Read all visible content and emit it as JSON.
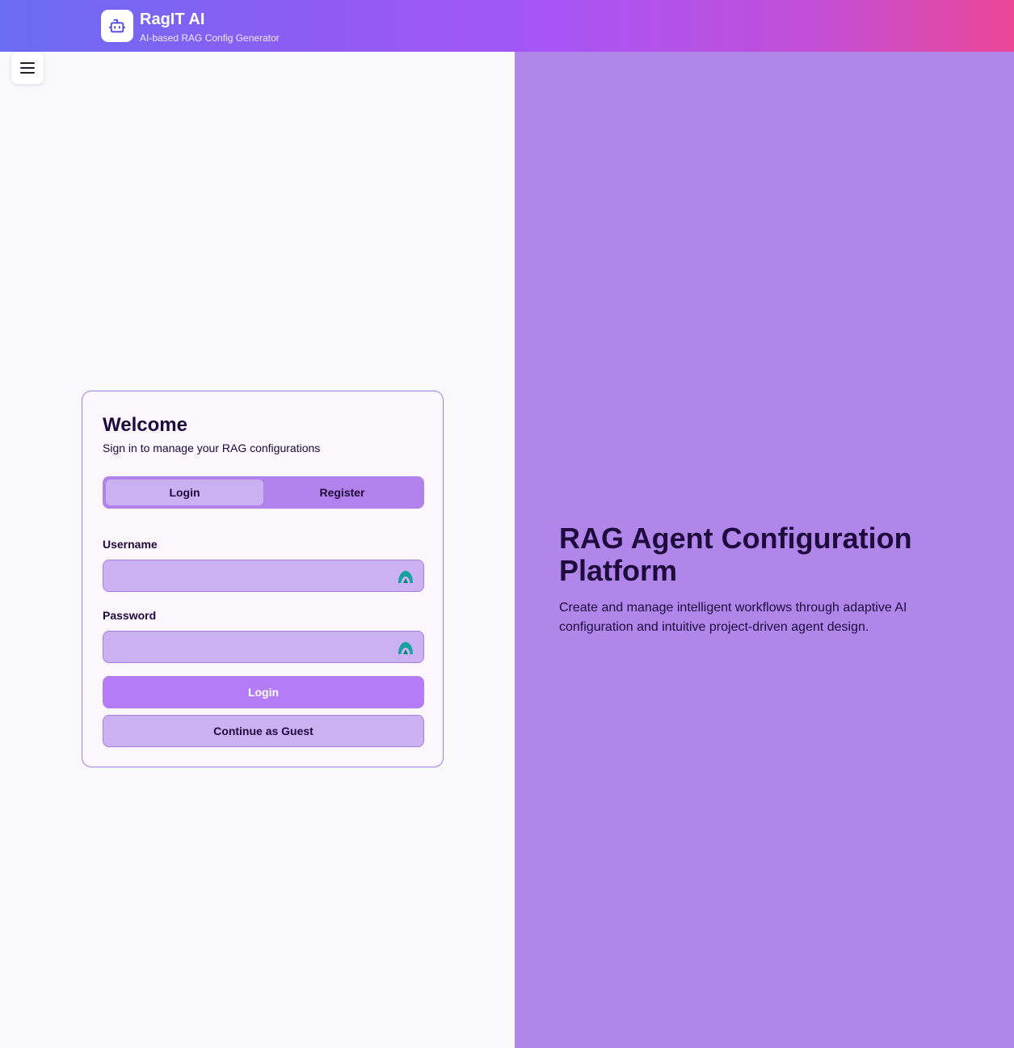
{
  "header": {
    "title": "RagIT AI",
    "subtitle": "AI-based RAG Config Generator",
    "logo_icon": "robot-icon",
    "gradient_colors": [
      "#6a6cf2",
      "#a855f5",
      "#ec4899"
    ]
  },
  "menu": {
    "icon": "hamburger-menu-icon"
  },
  "auth_card": {
    "title": "Welcome",
    "subtitle": "Sign in to manage your RAG configurations",
    "tabs": [
      {
        "label": "Login",
        "active": true
      },
      {
        "label": "Register",
        "active": false
      }
    ],
    "username_label": "Username",
    "username_value": "",
    "password_label": "Password",
    "password_value": "",
    "field_icon": "password-manager-icon",
    "login_button": "Login",
    "guest_button": "Continue as Guest"
  },
  "hero": {
    "title": "RAG Agent Configuration Platform",
    "description": "Create and manage intelligent workflows through adaptive AI configuration and intuitive project-driven agent design.",
    "background_color": "#b086ea"
  }
}
